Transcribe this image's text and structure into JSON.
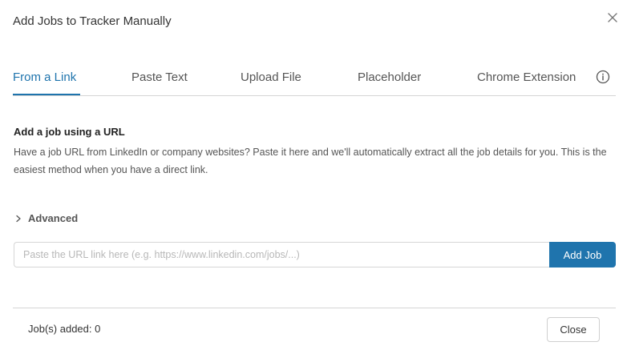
{
  "dialog": {
    "title": "Add Jobs to Tracker Manually",
    "close_icon": "close-icon"
  },
  "tabs": [
    {
      "label": "From a Link",
      "active": true
    },
    {
      "label": "Paste Text",
      "active": false
    },
    {
      "label": "Upload File",
      "active": false
    },
    {
      "label": "Placeholder",
      "active": false
    },
    {
      "label": "Chrome Extension",
      "active": false
    }
  ],
  "info_icon": "info-circle-icon",
  "section": {
    "heading": "Add a job using a URL",
    "description": "Have a job URL from LinkedIn or company websites? Paste it here and we'll automatically extract all the job details for you. This is the easiest method when you have a direct link."
  },
  "advanced": {
    "label": "Advanced",
    "icon": "chevron-right-icon"
  },
  "url_input": {
    "value": "",
    "placeholder": "Paste the URL link here (e.g. https://www.linkedin.com/jobs/...)"
  },
  "add_job_button": {
    "label": "Add Job"
  },
  "footer": {
    "jobs_added": "Job(s) added: 0",
    "close_label": "Close"
  },
  "colors": {
    "accent": "#1f74ad",
    "divider": "#d5d5d5",
    "text": "#333333"
  }
}
